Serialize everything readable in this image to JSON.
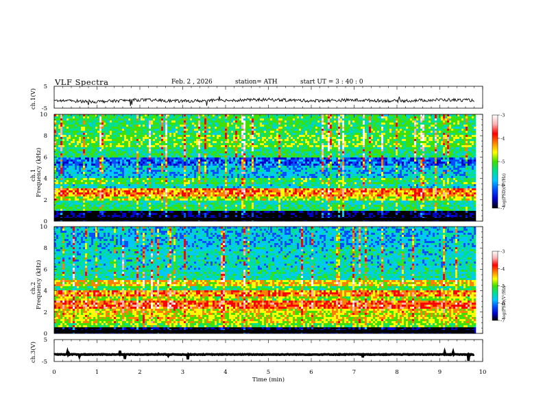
{
  "header": {
    "title": "VLF Spectra",
    "date": "Feb. 2 , 2026",
    "station": "station= ATH",
    "start_ut": "start UT =   3 : 40 : 0"
  },
  "colors": {
    "waveform": "#000000",
    "colormap": [
      "#000000",
      "#0000cc",
      "#0050ff",
      "#00c8ff",
      "#00e090",
      "#40e000",
      "#ffff00",
      "#ff8000",
      "#ff0000",
      "#ffb0b0",
      "#ffffff"
    ]
  },
  "chart_data": [
    {
      "type": "line",
      "panel": "ch1-waveform",
      "ylabel": "ch.1(V)",
      "ylim": [
        -5,
        5
      ],
      "ytick_labels": [
        "5",
        "-5"
      ],
      "x": [
        0,
        1,
        2,
        3,
        4,
        5,
        6,
        7,
        8,
        9,
        9.8
      ],
      "y": [
        -1.5,
        -2.0,
        -1.2,
        -1.8,
        -1.4,
        -1.1,
        -1.6,
        -1.3,
        -1.7,
        -1.2,
        -1.4
      ]
    },
    {
      "type": "heatmap",
      "panel": "ch1-spectrogram",
      "ylabel": "ch.1",
      "ylabel2": "Frequency (kHz)",
      "xlim": [
        0,
        10
      ],
      "ylim": [
        0,
        10
      ],
      "ytick_labels": [
        "0",
        "2",
        "4",
        "6",
        "8",
        "10"
      ],
      "colorbar": {
        "label": "log(PSD)(V²/Hz)",
        "range": [
          -7,
          -3
        ],
        "tick_labels": [
          "-3",
          "-4",
          "-5",
          "-6",
          "-7"
        ]
      },
      "frequency_bands_khz": [
        0,
        1,
        1.5,
        2,
        2.3,
        3,
        3.5,
        4,
        4.4,
        5.2,
        6,
        7,
        8,
        10
      ],
      "band_log_psd": [
        -7,
        -5.3,
        -5.5,
        -4.8,
        -4.2,
        -5.6,
        -5.2,
        -5.8,
        -5.8,
        -6.2,
        -5.3,
        -5.0,
        -5.2,
        -5.0
      ]
    },
    {
      "type": "heatmap",
      "panel": "ch2-spectrogram",
      "ylabel": "ch.2",
      "ylabel2": "Frequency (kHz)",
      "xlim": [
        0,
        10
      ],
      "ylim": [
        0,
        10
      ],
      "ytick_labels": [
        "0",
        "2",
        "4",
        "6",
        "8",
        "10"
      ],
      "colorbar": {
        "label": "log(PSD)(V²/Hz)",
        "range": [
          -7,
          -3
        ],
        "tick_labels": [
          "-3",
          "-4",
          "-5",
          "-6",
          "-7"
        ]
      },
      "frequency_bands_khz": [
        0,
        0.5,
        1,
        2,
        2.3,
        3,
        3.5,
        4,
        4.5,
        5,
        6,
        8,
        10
      ],
      "band_log_psd": [
        -7,
        -5.0,
        -4.7,
        -4.5,
        -4.0,
        -4.8,
        -4.2,
        -5.2,
        -4.5,
        -5.5,
        -5.6,
        -5.8,
        -5.9
      ]
    },
    {
      "type": "line",
      "panel": "ch3-waveform",
      "ylabel": "ch.3(V)",
      "ylim": [
        -5,
        5
      ],
      "ytick_labels": [
        "5",
        "-5"
      ],
      "xlabel": "Time (min)",
      "x_tick_labels": [
        "0",
        "1",
        "2",
        "3",
        "4",
        "5",
        "6",
        "7",
        "8",
        "9",
        "10"
      ],
      "xlim": [
        0,
        10
      ],
      "x": [
        0,
        9.8
      ],
      "y": [
        -1.8,
        -1.8
      ]
    }
  ]
}
